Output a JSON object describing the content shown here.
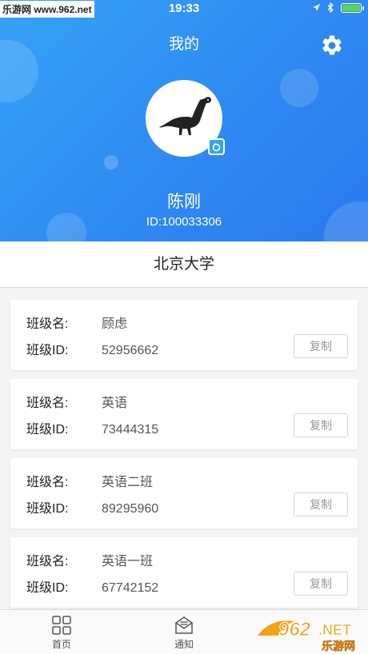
{
  "status_bar": {
    "watermark_site": "乐游网 www.962.net",
    "time": "19:33"
  },
  "header": {
    "title": "我的",
    "username": "陈刚",
    "user_id": "ID:100033306"
  },
  "school": "北京大学",
  "class_label": "班级名:",
  "class_id_label": "班级ID:",
  "copy_label": "复制",
  "classes": [
    {
      "name": "顾虑",
      "id": "52956662"
    },
    {
      "name": "英语",
      "id": "73444315"
    },
    {
      "name": "英语二班",
      "id": "89295960"
    },
    {
      "name": "英语一班",
      "id": "67742152"
    }
  ],
  "tabbar": {
    "items": [
      {
        "label": "首页",
        "icon": "grid-icon"
      },
      {
        "label": "通知",
        "icon": "envelope-icon"
      }
    ]
  },
  "watermark": {
    "logo_text": "962",
    "suffix": ".NET",
    "caption": "乐游网"
  },
  "colors": {
    "header_gradient_start": "#35a3f6",
    "header_gradient_end": "#2a79ee",
    "accent": "#33a6ef"
  }
}
